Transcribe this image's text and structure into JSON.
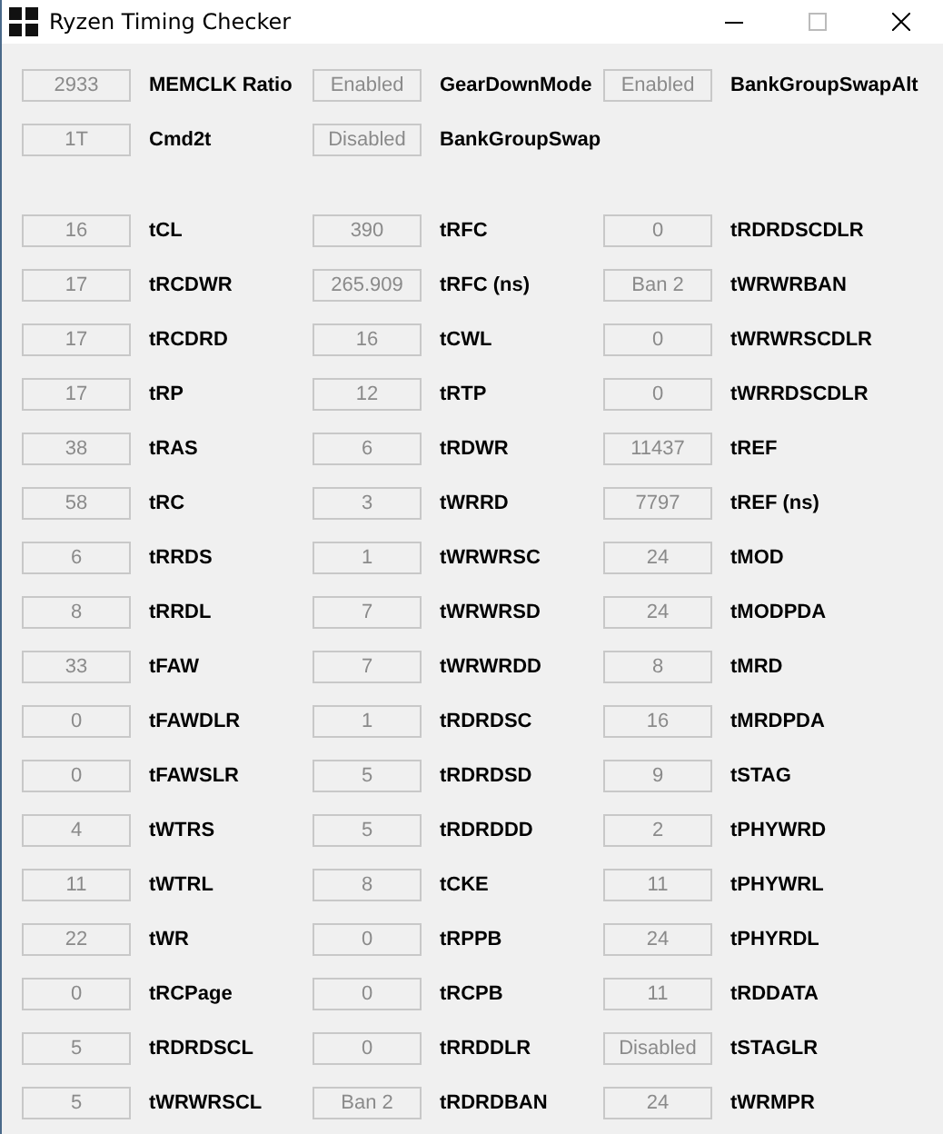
{
  "window": {
    "title": "Ryzen Timing Checker"
  },
  "settings_rows": [
    [
      {
        "reading": "2933",
        "name": "MEMCLK Ratio"
      },
      {
        "reading": "Enabled",
        "name": "GearDownMode"
      },
      {
        "reading": "Enabled",
        "name": "BankGroupSwapAlt"
      }
    ],
    [
      {
        "reading": "1T",
        "name": "Cmd2t"
      },
      {
        "reading": "Disabled",
        "name": "BankGroupSwap"
      }
    ]
  ],
  "timing_rows": [
    [
      {
        "reading": "16",
        "name": "tCL"
      },
      {
        "reading": "390",
        "name": "tRFC"
      },
      {
        "reading": "0",
        "name": "tRDRDSCDLR"
      }
    ],
    [
      {
        "reading": "17",
        "name": "tRCDWR"
      },
      {
        "reading": "265.909",
        "name": "tRFC (ns)"
      },
      {
        "reading": "Ban 2",
        "name": "tWRWRBAN"
      }
    ],
    [
      {
        "reading": "17",
        "name": "tRCDRD"
      },
      {
        "reading": "16",
        "name": "tCWL"
      },
      {
        "reading": "0",
        "name": "tWRWRSCDLR"
      }
    ],
    [
      {
        "reading": "17",
        "name": "tRP"
      },
      {
        "reading": "12",
        "name": "tRTP"
      },
      {
        "reading": "0",
        "name": "tWRRDSCDLR"
      }
    ],
    [
      {
        "reading": "38",
        "name": "tRAS"
      },
      {
        "reading": "6",
        "name": "tRDWR"
      },
      {
        "reading": "11437",
        "name": "tREF"
      }
    ],
    [
      {
        "reading": "58",
        "name": "tRC"
      },
      {
        "reading": "3",
        "name": "tWRRD"
      },
      {
        "reading": "7797",
        "name": "tREF (ns)"
      }
    ],
    [
      {
        "reading": "6",
        "name": "tRRDS"
      },
      {
        "reading": "1",
        "name": "tWRWRSC"
      },
      {
        "reading": "24",
        "name": "tMOD"
      }
    ],
    [
      {
        "reading": "8",
        "name": "tRRDL"
      },
      {
        "reading": "7",
        "name": "tWRWRSD"
      },
      {
        "reading": "24",
        "name": "tMODPDA"
      }
    ],
    [
      {
        "reading": "33",
        "name": "tFAW"
      },
      {
        "reading": "7",
        "name": "tWRWRDD"
      },
      {
        "reading": "8",
        "name": "tMRD"
      }
    ],
    [
      {
        "reading": "0",
        "name": "tFAWDLR"
      },
      {
        "reading": "1",
        "name": "tRDRDSC"
      },
      {
        "reading": "16",
        "name": "tMRDPDA"
      }
    ],
    [
      {
        "reading": "0",
        "name": "tFAWSLR"
      },
      {
        "reading": "5",
        "name": "tRDRDSD"
      },
      {
        "reading": "9",
        "name": "tSTAG"
      }
    ],
    [
      {
        "reading": "4",
        "name": "tWTRS"
      },
      {
        "reading": "5",
        "name": "tRDRDDD"
      },
      {
        "reading": "2",
        "name": "tPHYWRD"
      }
    ],
    [
      {
        "reading": "11",
        "name": "tWTRL"
      },
      {
        "reading": "8",
        "name": "tCKE"
      },
      {
        "reading": "11",
        "name": "tPHYWRL"
      }
    ],
    [
      {
        "reading": "22",
        "name": "tWR"
      },
      {
        "reading": "0",
        "name": "tRPPB"
      },
      {
        "reading": "24",
        "name": "tPHYRDL"
      }
    ],
    [
      {
        "reading": "0",
        "name": "tRCPage"
      },
      {
        "reading": "0",
        "name": "tRCPB"
      },
      {
        "reading": "11",
        "name": "tRDDATA"
      }
    ],
    [
      {
        "reading": "5",
        "name": "tRDRDSCL"
      },
      {
        "reading": "0",
        "name": "tRRDDLR"
      },
      {
        "reading": "Disabled",
        "name": "tSTAGLR"
      }
    ],
    [
      {
        "reading": "5",
        "name": "tWRWRSCL"
      },
      {
        "reading": "Ban 2",
        "name": "tRDRDBAN"
      },
      {
        "reading": "24",
        "name": "tWRMPR"
      }
    ]
  ]
}
